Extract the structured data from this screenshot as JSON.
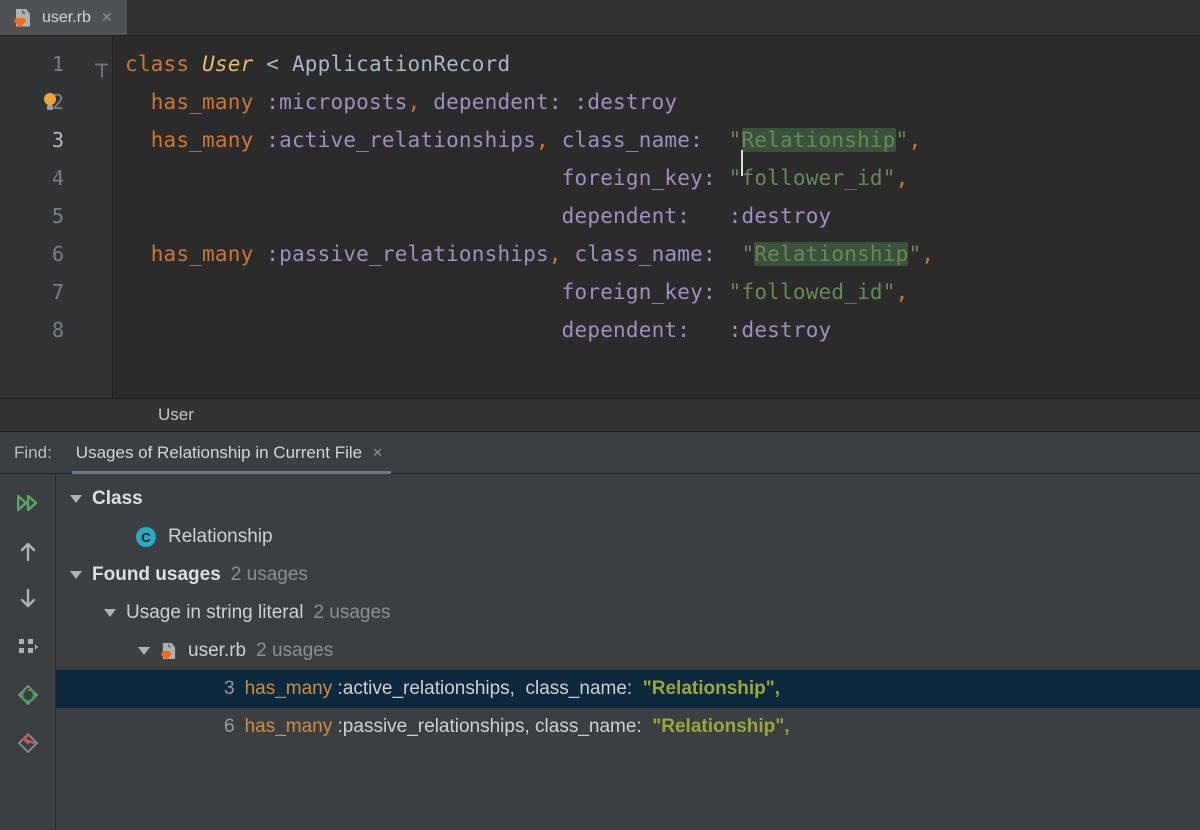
{
  "tab": {
    "filename": "user.rb"
  },
  "code_lines": {
    "l1_kw": "class ",
    "l1_cls": "User",
    "l1_rest": " < ApplicationRecord",
    "l2_ind": "  ",
    "l2_kw": "has_many ",
    "l2_sym": ":microposts",
    "l2_comma": ", ",
    "l2_key": "dependent:",
    "l2_sp": " ",
    "l2_val": ":destroy",
    "l3_ind": "  ",
    "l3_kw": "has_many ",
    "l3_sym": ":active_relationships",
    "l3_comma": ", ",
    "l3_key": "class_name:",
    "l3_sp": "  ",
    "l3_q1": "\"",
    "l3_str": "Relationship",
    "l3_q2": "\"",
    "l3_end": ",",
    "l4_pad": "                                  ",
    "l4_key": "foreign_key:",
    "l4_sp": " ",
    "l4_q1": "\"",
    "l4_str": "follower_id",
    "l4_q2": "\"",
    "l4_end": ",",
    "l5_pad": "                                  ",
    "l5_key": "dependent:",
    "l5_sp": "   ",
    "l5_val": ":destroy",
    "l6_ind": "  ",
    "l6_kw": "has_many ",
    "l6_sym": ":passive_relationships",
    "l6_comma": ", ",
    "l6_key": "class_name:",
    "l6_sp": "  ",
    "l6_q1": "\"",
    "l6_str": "Relationship",
    "l6_q2": "\"",
    "l6_end": ",",
    "l7_pad": "                                  ",
    "l7_key": "foreign_key:",
    "l7_sp": " ",
    "l7_q1": "\"",
    "l7_str": "followed_id",
    "l7_q2": "\"",
    "l7_end": ",",
    "l8_pad": "                                  ",
    "l8_key": "dependent:",
    "l8_sp": "   ",
    "l8_val": ":destroy"
  },
  "gutter": [
    "1",
    "2",
    "3",
    "4",
    "5",
    "6",
    "7",
    "8"
  ],
  "breadcrumb": "User",
  "find": {
    "label": "Find:",
    "tab_title": "Usages of Relationship in Current File",
    "tree": {
      "class_header": "Class",
      "class_name": "Relationship",
      "found_header": "Found usages",
      "found_count": "2 usages",
      "literal_header": "Usage in string literal",
      "literal_count": "2 usages",
      "file_name": "user.rb",
      "file_count": "2 usages",
      "u1": {
        "num": "3",
        "kw": "has_many ",
        "mid": ":active_relationships,  class_name:  ",
        "q": "\"",
        "rel": "Relationship",
        "end": "\","
      },
      "u2": {
        "num": "6",
        "kw": "has_many ",
        "mid": ":passive_relationships, class_name:  ",
        "q": "\"",
        "rel": "Relationship",
        "end": "\","
      }
    }
  }
}
